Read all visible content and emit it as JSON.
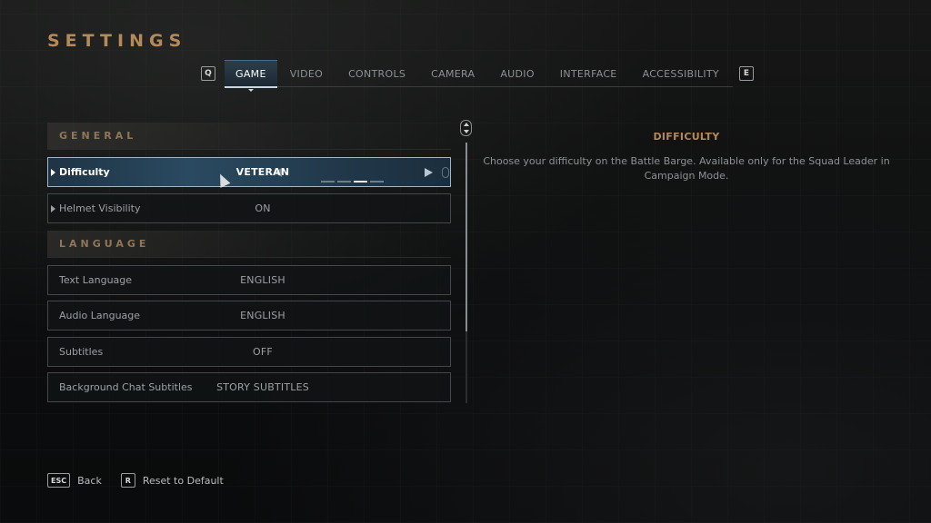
{
  "page": {
    "title": "SETTINGS"
  },
  "tabs": {
    "prev_key": "Q",
    "next_key": "E",
    "items": [
      {
        "label": "GAME",
        "active": true
      },
      {
        "label": "VIDEO"
      },
      {
        "label": "CONTROLS"
      },
      {
        "label": "CAMERA"
      },
      {
        "label": "AUDIO"
      },
      {
        "label": "INTERFACE"
      },
      {
        "label": "ACCESSIBILITY"
      }
    ]
  },
  "sections": {
    "general": {
      "title": "GENERAL",
      "rows": [
        {
          "label": "Difficulty",
          "value": "VETERAN",
          "selected": true,
          "option_count": 4,
          "selected_index": 2
        },
        {
          "label": "Helmet Visibility",
          "value": "ON"
        }
      ]
    },
    "language": {
      "title": "LANGUAGE",
      "rows": [
        {
          "label": "Text Language",
          "value": "ENGLISH"
        },
        {
          "label": "Audio Language",
          "value": "ENGLISH"
        },
        {
          "label": "Subtitles",
          "value": "OFF"
        },
        {
          "label": "Background Chat Subtitles",
          "value": "STORY SUBTITLES"
        }
      ]
    }
  },
  "description": {
    "title": "DIFFICULTY",
    "text": "Choose your difficulty on the Battle Barge. Available only for the Squad Leader in Campaign Mode."
  },
  "footer": {
    "back_key": "ESC",
    "back_label": "Back",
    "reset_key": "R",
    "reset_label": "Reset to Default"
  },
  "colors": {
    "accent": "#b58a58",
    "selected_row": "#2a4a61"
  },
  "icons": {
    "scroll": "mouse-scroll-icon",
    "cursor": "pointer-cursor-icon"
  }
}
